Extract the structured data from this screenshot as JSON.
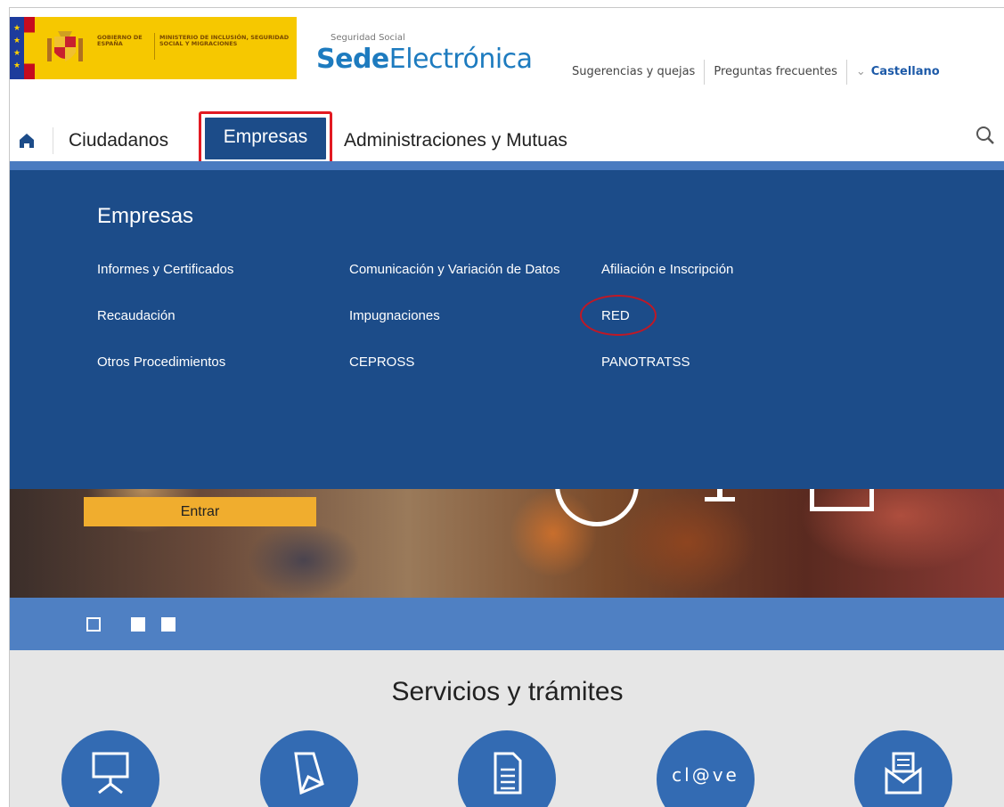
{
  "header": {
    "gov_line1": "GOBIERNO DE ESPAÑA",
    "gov_line2": "MINISTERIO DE INCLUSIÓN, SEGURIDAD SOCIAL Y MIGRACIONES",
    "sede_small": "Seguridad Social",
    "sede_bold": "Sede",
    "sede_light": "Electrónica",
    "links": [
      "Sugerencias y quejas",
      "Preguntas frecuentes"
    ],
    "language": "Castellano"
  },
  "nav": {
    "items": [
      "Ciudadanos",
      "Empresas",
      "Administraciones y Mutuas"
    ],
    "active": "Empresas"
  },
  "mega_menu": {
    "title": "Empresas",
    "links": [
      "Informes y Certificados",
      "Comunicación y Variación de Datos",
      "Afiliación e Inscripción",
      "Recaudación",
      "Impugnaciones",
      "RED",
      "Otros Procedimientos",
      "CEPROSS",
      "PANOTRATSS"
    ],
    "highlighted": "RED"
  },
  "hero": {
    "enter_label": "Entrar",
    "carousel_current": 1,
    "carousel_total": 3
  },
  "services": {
    "title": "Servicios y trámites",
    "icons": [
      "presentation-icon",
      "document-fold-icon",
      "document-lines-icon",
      "clave-logo",
      "envelope-icon"
    ],
    "clave_text": "cl@ve"
  },
  "colors": {
    "primary_blue": "#1c4c89",
    "accent_blue": "#4f80c3",
    "highlight_red": "#e21a22",
    "button_yellow": "#f0ad2e",
    "logo_yellow": "#f6c800"
  }
}
